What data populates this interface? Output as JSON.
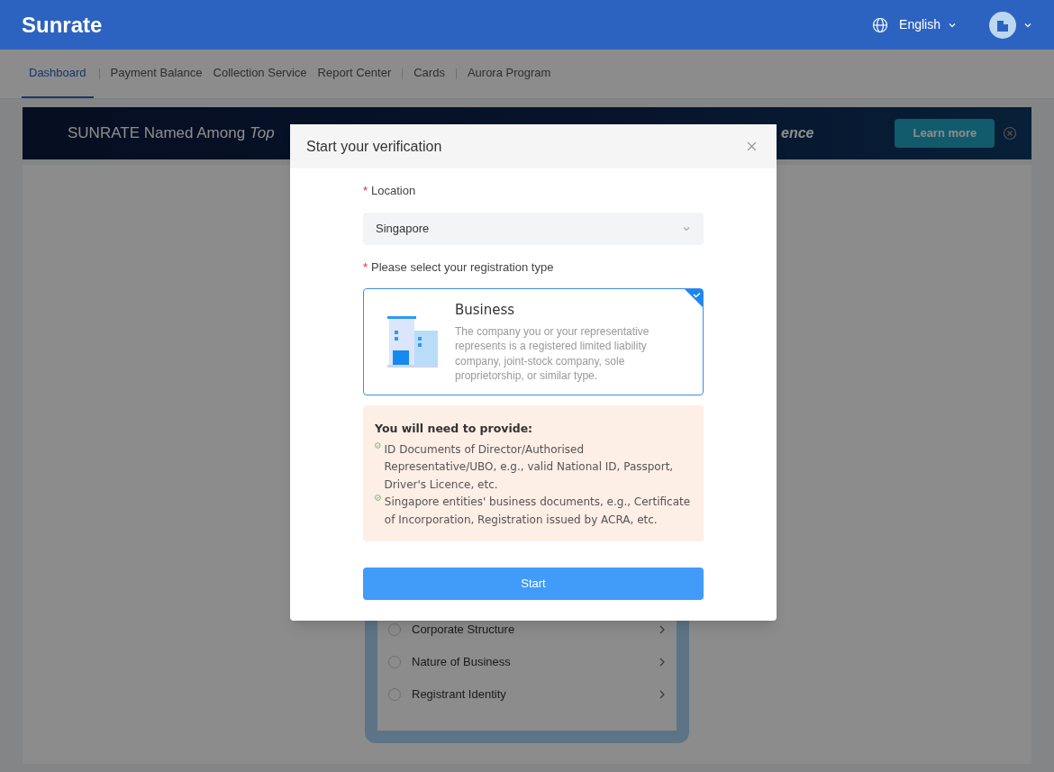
{
  "header": {
    "logo": "Sunrate",
    "language": "English"
  },
  "nav": {
    "tabs": [
      {
        "label": "Dashboard",
        "selected": true,
        "divider": true
      },
      {
        "label": "Payment Balance",
        "selected": false,
        "divider": false
      },
      {
        "label": "Collection Service",
        "selected": false,
        "divider": false
      },
      {
        "label": "Report Center",
        "selected": false,
        "divider": true
      },
      {
        "label": "Cards",
        "selected": false,
        "divider": true
      },
      {
        "label": "Aurora Program",
        "selected": false,
        "divider": false
      }
    ]
  },
  "banner": {
    "headline_start": "SUNRATE Named Among *Top*",
    "headline_end": "ence",
    "button": "Learn more"
  },
  "checklist": {
    "steps": [
      {
        "label": "Corporate Structure"
      },
      {
        "label": "Nature of Business"
      },
      {
        "label": "Registrant Identity"
      }
    ]
  },
  "modal": {
    "title": "Start your verification",
    "location": {
      "required_mark": "*",
      "label": "Location",
      "value": "Singapore"
    },
    "type_required_mark": "*",
    "type_label": "Please select your registration type",
    "types": [
      {
        "title": "Business",
        "description": "The company you or your representative represents is a registered limited liability company, joint-stock company, sole proprietorship, or similar type.",
        "selected": true
      }
    ],
    "requirements": {
      "title": "You will need to provide:",
      "items": [
        "ID Documents of Director/Authorised Representative/UBO, e.g., valid National ID, Passport, Driver's Licence, etc.",
        "Singapore entities' business documents, e.g., Certificate of Incorporation, Registration issued by ACRA, etc."
      ]
    },
    "button": "Start"
  }
}
